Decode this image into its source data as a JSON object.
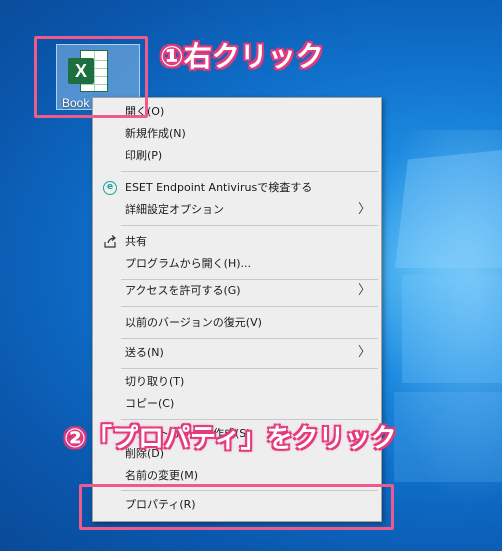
{
  "desktop": {
    "icon_label": "Book",
    "icon_badge": "X"
  },
  "callouts": {
    "step1": "①右クリック",
    "step2": "②「プロパティ」をクリック"
  },
  "context_menu": {
    "items": [
      {
        "label": "開く(O)"
      },
      {
        "label": "新規作成(N)"
      },
      {
        "label": "印刷(P)"
      },
      {
        "label": "ESET Endpoint Antivirusで検査する",
        "icon": "eset-icon"
      },
      {
        "label": "詳細設定オプション",
        "arrow": "〉"
      },
      {
        "label": "共有",
        "icon": "share-icon"
      },
      {
        "label": "プログラムから開く(H)..."
      },
      {
        "label": "アクセスを許可する(G)",
        "arrow": "〉"
      },
      {
        "label": "以前のバージョンの復元(V)"
      },
      {
        "label": "送る(N)",
        "arrow": "〉"
      },
      {
        "label": "切り取り(T)"
      },
      {
        "label": "コピー(C)"
      },
      {
        "label": "ショートカットの作成(S)"
      },
      {
        "label": "削除(D)"
      },
      {
        "label": "名前の変更(M)"
      },
      {
        "label": "プロパティ(R)"
      }
    ]
  },
  "colors": {
    "highlight": "#ee5a8a",
    "excel_green": "#1d6f42",
    "eset_teal": "#1ba39c"
  }
}
